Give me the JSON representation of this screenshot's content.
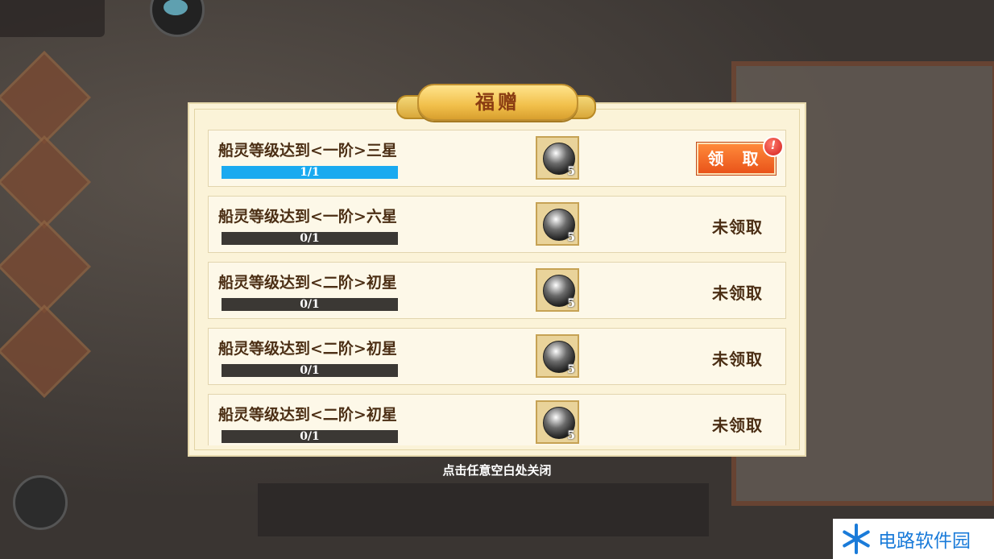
{
  "modal": {
    "title": "福赠",
    "close_hint": "点击任意空白处关闭"
  },
  "rewards": [
    {
      "name": "船灵等级达到<一阶>三星",
      "progress_text": "1/1",
      "progress": 1.0,
      "item_qty": "5",
      "action": "领 取",
      "claimable": true,
      "badge": "!"
    },
    {
      "name": "船灵等级达到<一阶>六星",
      "progress_text": "0/1",
      "progress": 0.0,
      "item_qty": "5",
      "status": "未领取"
    },
    {
      "name": "船灵等级达到<二阶>初星",
      "progress_text": "0/1",
      "progress": 0.0,
      "item_qty": "5",
      "status": "未领取"
    },
    {
      "name": "船灵等级达到<二阶>初星",
      "progress_text": "0/1",
      "progress": 0.0,
      "item_qty": "5",
      "status": "未领取"
    },
    {
      "name": "船灵等级达到<二阶>初星",
      "progress_text": "0/1",
      "progress": 0.0,
      "item_qty": "5",
      "status": "未领取"
    }
  ],
  "watermark": {
    "text": "电路软件园"
  },
  "colors": {
    "progress_fill": "#1aaaf0",
    "progress_track": "#3b3834",
    "claim_button": "#f26a24",
    "text": "#4b2e14"
  }
}
